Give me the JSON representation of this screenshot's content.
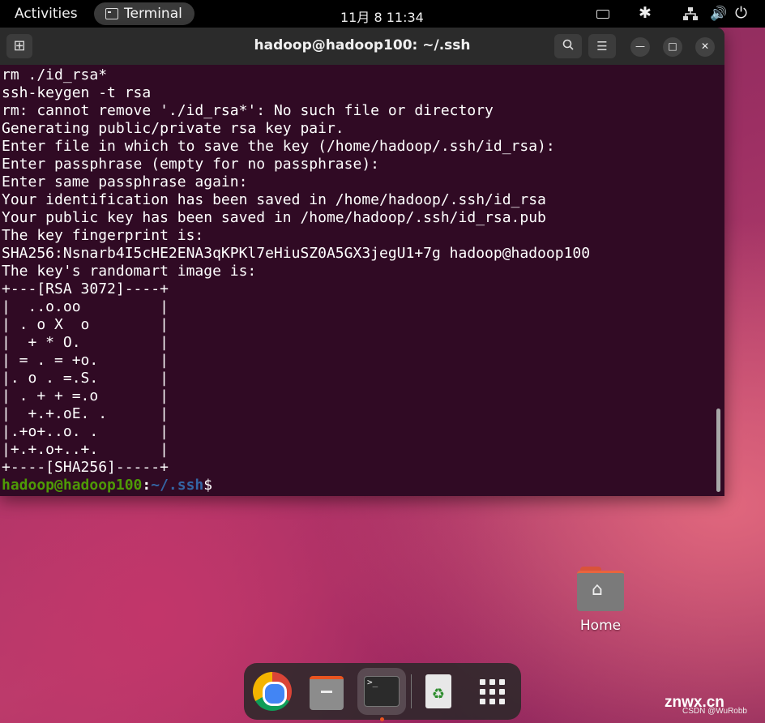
{
  "topbar": {
    "activities": "Activities",
    "app_name": "Terminal",
    "clock": "11月 8  11:34"
  },
  "window": {
    "title": "hadoop@hadoop100: ~/.ssh"
  },
  "terminal": {
    "lines": [
      "rm ./id_rsa*",
      "ssh-keygen -t rsa",
      "rm: cannot remove './id_rsa*': No such file or directory",
      "Generating public/private rsa key pair.",
      "Enter file in which to save the key (/home/hadoop/.ssh/id_rsa):",
      "Enter passphrase (empty for no passphrase):",
      "Enter same passphrase again:",
      "Your identification has been saved in /home/hadoop/.ssh/id_rsa",
      "Your public key has been saved in /home/hadoop/.ssh/id_rsa.pub",
      "The key fingerprint is:",
      "SHA256:Nsnarb4I5cHE2ENA3qKPKl7eHiuSZ0A5GX3jegU1+7g hadoop@hadoop100",
      "The key's randomart image is:",
      "+---[RSA 3072]----+",
      "|  ..o.oo         |",
      "| . o X  o        |",
      "|  + * O.         |",
      "| = . = +o.       |",
      "|. o . =.S.       |",
      "| . + + =.o       |",
      "|  +.+.oE. .      |",
      "|.+o+..o. .       |",
      "|+.+.o+..+.       |",
      "+----[SHA256]-----+"
    ],
    "prompt_user": "hadoop@hadoop100",
    "prompt_sep": ":",
    "prompt_path": "~/.ssh",
    "prompt_symbol": "$"
  },
  "desktop": {
    "home_label": "Home"
  },
  "watermark": {
    "site": "znwx.cn",
    "credit": "CSDN @WuRobb"
  }
}
